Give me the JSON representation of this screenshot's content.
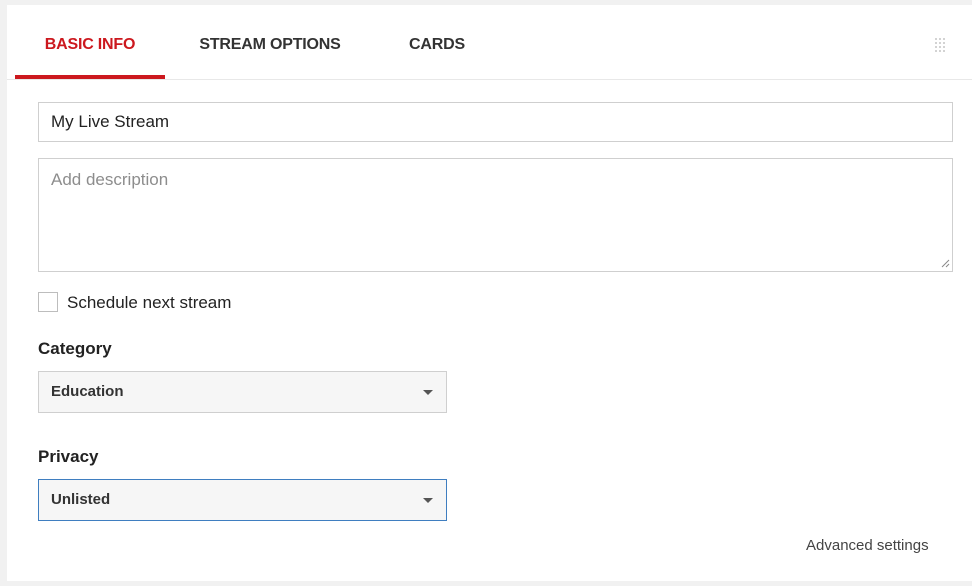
{
  "tabs": [
    {
      "label": "BASIC INFO",
      "active": true
    },
    {
      "label": "STREAM OPTIONS",
      "active": false
    },
    {
      "label": "CARDS",
      "active": false
    }
  ],
  "title_field": {
    "value": "My Live Stream"
  },
  "description_field": {
    "value": "",
    "placeholder": "Add description"
  },
  "schedule": {
    "label": "Schedule next stream",
    "checked": false
  },
  "category": {
    "label": "Category",
    "selected": "Education"
  },
  "privacy": {
    "label": "Privacy",
    "selected": "Unlisted"
  },
  "advanced_link": "Advanced settings",
  "colors": {
    "accent": "#cc181e",
    "focus_border": "#3f7ec0",
    "background": "#f1f1f1"
  },
  "icons": {
    "grip": "drag-grip-icon",
    "select_arrow": "caret-down-icon",
    "resize": "textarea-resize-icon"
  }
}
